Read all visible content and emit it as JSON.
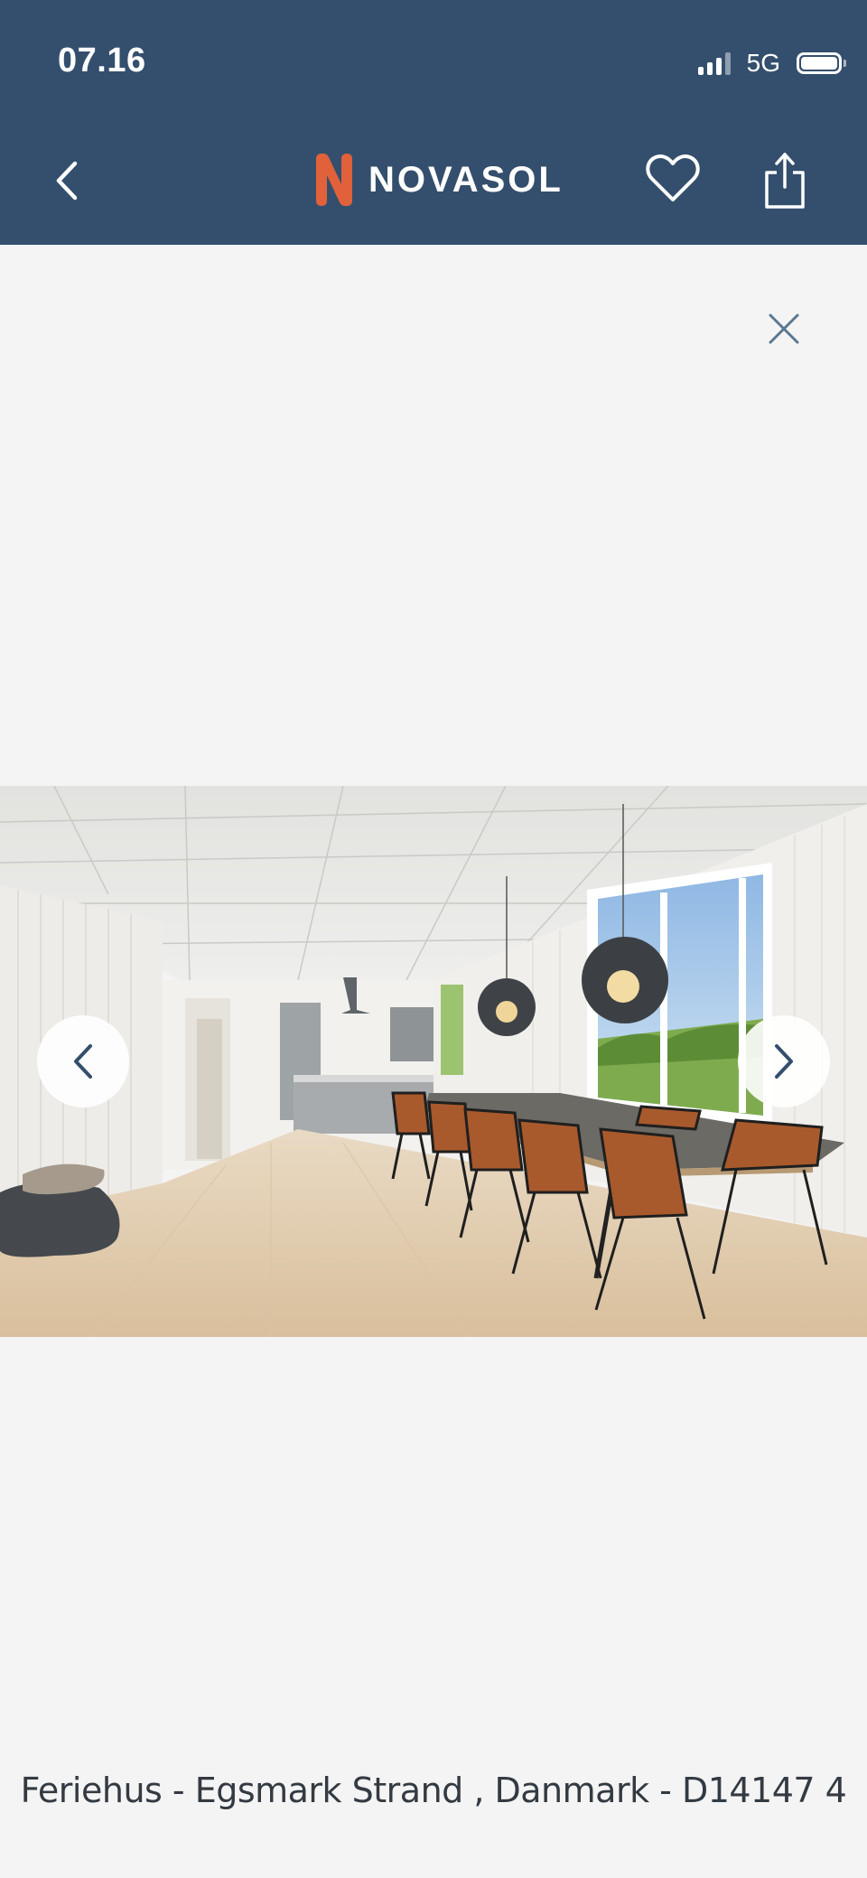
{
  "status_bar": {
    "time": "07.16",
    "network": "5G"
  },
  "header": {
    "brand": "NOVASOL",
    "back_icon": "chevron-left-icon",
    "favorite_icon": "heart-icon",
    "share_icon": "share-icon"
  },
  "gallery": {
    "close_icon": "close-icon",
    "prev_icon": "chevron-left-icon",
    "next_icon": "chevron-right-icon",
    "caption": "Feriehus - Egsmark Strand , Danmark - D14147 4"
  },
  "colors": {
    "header_bg": "#344f6d",
    "page_bg": "#f4f4f4",
    "brand_orange": "#e0613a",
    "close_icon": "#5a7891"
  }
}
